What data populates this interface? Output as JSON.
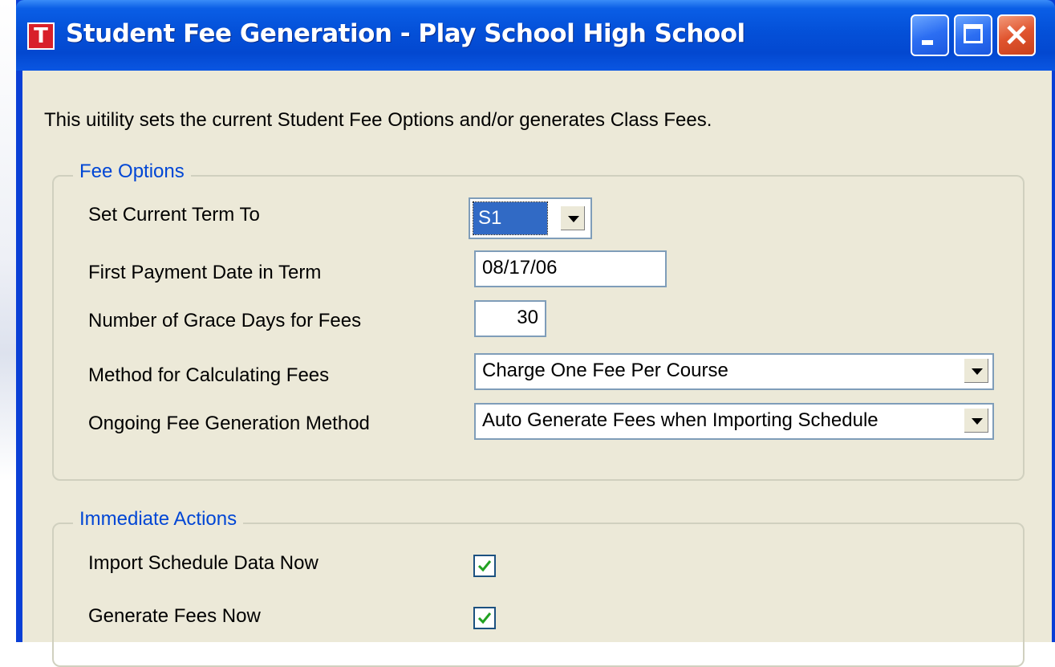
{
  "window": {
    "title": "Student Fee Generation - Play School High School",
    "icon_letter": "T",
    "buttons": [
      "minimize",
      "maximize",
      "close"
    ]
  },
  "intro_text": "This uitility sets the current Student Fee Options and/or generates Class Fees.",
  "fee_options": {
    "legend": "Fee Options",
    "current_term": {
      "label": "Set Current Term To",
      "value": "S1"
    },
    "first_payment_date": {
      "label": "First Payment Date in Term",
      "value": "08/17/06"
    },
    "grace_days": {
      "label": "Number of Grace Days for Fees",
      "value": "30"
    },
    "calc_method": {
      "label": "Method for Calculating Fees",
      "value": "Charge One Fee Per Course"
    },
    "ongoing_method": {
      "label": "Ongoing Fee Generation Method",
      "value": "Auto Generate Fees when Importing Schedule"
    }
  },
  "immediate_actions": {
    "legend": "Immediate Actions",
    "import_schedule": {
      "label": "Import Schedule Data Now",
      "checked": true
    },
    "generate_fees": {
      "label": "Generate Fees Now",
      "checked": true
    }
  },
  "colors": {
    "titlebar": "#0450d8",
    "client_bg": "#ece9d8",
    "legend_text": "#0046d5",
    "selection": "#316ac5",
    "check": "#21a121"
  },
  "icons": [
    "app-t-icon",
    "minimize-icon",
    "maximize-icon",
    "close-icon",
    "chevron-down-icon",
    "checkmark-icon"
  ]
}
